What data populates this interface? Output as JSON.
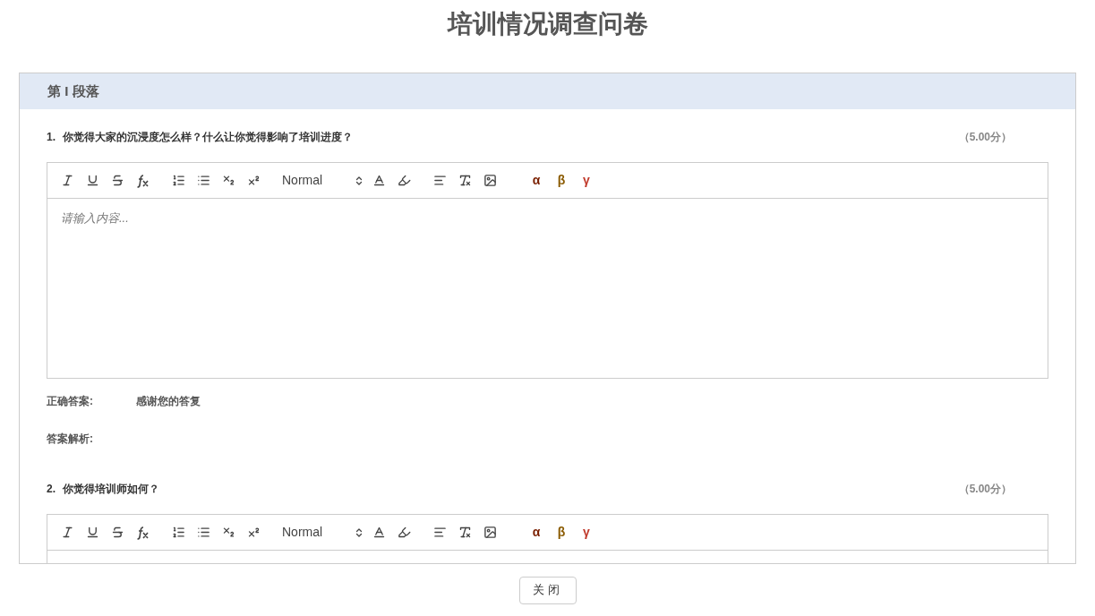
{
  "title": "培训情况调查问卷",
  "section": {
    "heading": "第 I 段落"
  },
  "questions": [
    {
      "number": "1.",
      "text": "你觉得大家的沉浸度怎么样？什么让你觉得影响了培训进度？",
      "score": "（5.00分）",
      "editor": {
        "font_picker": "Normal",
        "symbols": [
          {
            "label": "α",
            "color": "#7a1f00"
          },
          {
            "label": "β",
            "color": "#8a5a00"
          },
          {
            "label": "γ",
            "color": "#c0392b"
          }
        ],
        "placeholder": "请输入内容..."
      },
      "answer": {
        "label": "正确答案:",
        "value": "感谢您的答复"
      },
      "analysis": {
        "label": "答案解析:"
      }
    },
    {
      "number": "2.",
      "text": "你觉得培训师如何？",
      "score": "（5.00分）",
      "editor": {
        "font_picker": "Normal",
        "symbols": [
          {
            "label": "α",
            "color": "#7a1f00"
          },
          {
            "label": "β",
            "color": "#8a5a00"
          },
          {
            "label": "γ",
            "color": "#c0392b"
          }
        ]
      }
    }
  ],
  "close_button": "关闭"
}
